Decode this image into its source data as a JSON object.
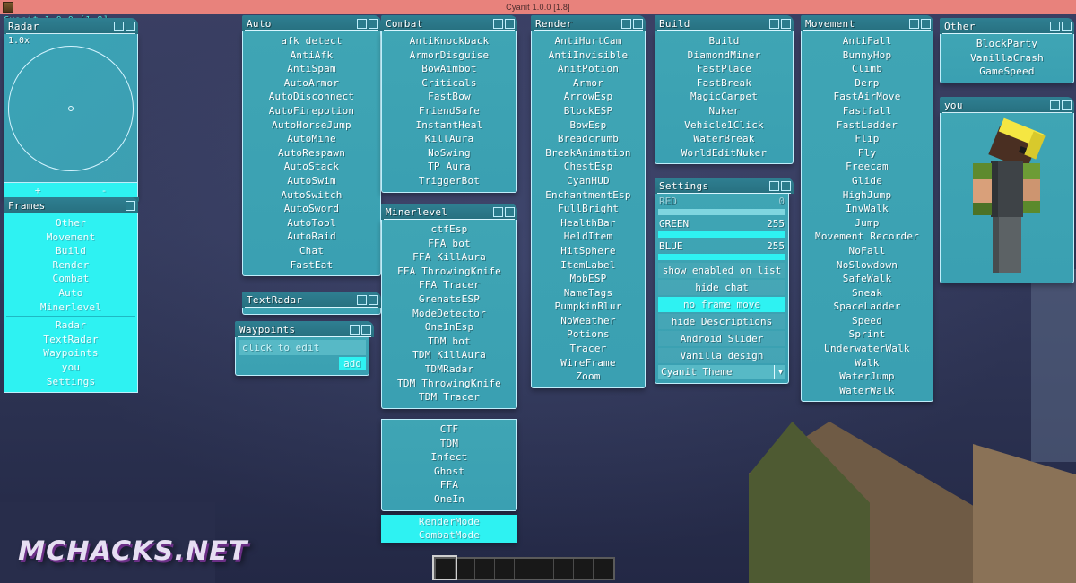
{
  "window": {
    "title": "Cyanit 1.0.0 [1.8]",
    "icon": "minecraft-grass-block-icon"
  },
  "watermark": {
    "client": "Cyanit 1.0.0 [1.8]",
    "site": "MCHACKS.NET"
  },
  "theme": {
    "accent": "#2ef2f2",
    "panel_bg": "#3fa5b4",
    "panel_header": "#2f7f92",
    "border": "#bfeefb",
    "text": "#ffffff",
    "titlebar": "#e8827c"
  },
  "panels": {
    "radar": {
      "title": "Radar",
      "scale": "1.0x",
      "zoom_in": "+",
      "zoom_out": "-"
    },
    "frames": {
      "title": "Frames",
      "group_a": [
        "Other",
        "Movement",
        "Build",
        "Render",
        "Combat",
        "Auto",
        "Minerlevel"
      ],
      "group_b": [
        "Radar",
        "TextRadar",
        "Waypoints",
        "you",
        "Settings"
      ]
    },
    "auto": {
      "title": "Auto",
      "items": [
        "afk detect",
        "AntiAfk",
        "AntiSpam",
        "AutoArmor",
        "AutoDisconnect",
        "AutoFirepotion",
        "AutoHorseJump",
        "AutoMine",
        "AutoRespawn",
        "AutoStack",
        "AutoSwim",
        "AutoSwitch",
        "AutoSword",
        "AutoTool",
        "AutoRaid",
        "Chat",
        "FastEat"
      ]
    },
    "textradar": {
      "title": "TextRadar"
    },
    "waypoints": {
      "title": "Waypoints",
      "input_placeholder": "click to edit",
      "add_label": "add"
    },
    "combat": {
      "title": "Combat",
      "items": [
        "AntiKnockback",
        "ArmorDisguise",
        "BowAimbot",
        "Criticals",
        "FastBow",
        "FriendSafe",
        "InstantHeal",
        "KillAura",
        "NoSwing",
        "TP Aura",
        "TriggerBot"
      ]
    },
    "minerlevel": {
      "title": "Minerlevel",
      "items": [
        "ctfEsp",
        "FFA bot",
        "FFA KillAura",
        "FFA ThrowingKnife",
        "FFA Tracer",
        "GrenatsESP",
        "ModeDetector",
        "OneInEsp",
        "TDM bot",
        "TDM KillAura",
        "TDMRadar",
        "TDM ThrowingKnife",
        "TDM Tracer"
      ],
      "modes": [
        "CTF",
        "TDM",
        "Infect",
        "Ghost",
        "FFA",
        "OneIn"
      ],
      "active_modes": [
        "RenderMode",
        "CombatMode"
      ]
    },
    "render": {
      "title": "Render",
      "items": [
        "AntiHurtCam",
        "AntiInvisible",
        "AnitPotion",
        "Armor",
        "ArrowEsp",
        "BlockESP",
        "BowEsp",
        "Breadcrumb",
        "BreakAnimation",
        "ChestEsp",
        "CyanHUD",
        "EnchantmentEsp",
        "FullBright",
        "HealthBar",
        "HeldItem",
        "HitSphere",
        "ItemLabel",
        "MobESP",
        "NameTags",
        "PumpkinBlur",
        "NoWeather",
        "Potions",
        "Tracer",
        "WireFrame",
        "Zoom"
      ]
    },
    "build": {
      "title": "Build",
      "items": [
        "Build",
        "DiamondMiner",
        "FastPlace",
        "FastBreak",
        "MagicCarpet",
        "Nuker",
        "Vehicle1Click",
        "WaterBreak",
        "WorldEditNuker"
      ]
    },
    "settings": {
      "title": "Settings",
      "sliders": [
        {
          "label": "RED",
          "value": "0",
          "fill": 0,
          "dim": true
        },
        {
          "label": "GREEN",
          "value": "255",
          "fill": 100,
          "dim": false
        },
        {
          "label": "BLUE",
          "value": "255",
          "fill": 100,
          "dim": false
        }
      ],
      "buttons": [
        {
          "label": "show enabled on list",
          "active": false
        },
        {
          "label": "hide chat",
          "active": false
        },
        {
          "label": "no frame move",
          "active": true
        },
        {
          "label": "hide Descriptions",
          "active": false
        },
        {
          "label": "Android Slider",
          "active": false
        },
        {
          "label": "Vanilla design",
          "active": false
        }
      ],
      "theme_selected": "Cyanit Theme"
    },
    "movement": {
      "title": "Movement",
      "items": [
        "AntiFall",
        "BunnyHop",
        "Climb",
        "Derp",
        "FastAirMove",
        "Fastfall",
        "FastLadder",
        "Flip",
        "Fly",
        "Freecam",
        "Glide",
        "HighJump",
        "InvWalk",
        "Jump",
        "Movement Recorder",
        "NoFall",
        "NoSlowdown",
        "SafeWalk",
        "Sneak",
        "SpaceLadder",
        "Speed",
        "Sprint",
        "UnderwaterWalk",
        "Walk",
        "WaterJump",
        "WaterWalk"
      ]
    },
    "other": {
      "title": "Other",
      "items": [
        "BlockParty",
        "VanillaCrash",
        "GameSpeed"
      ]
    },
    "you": {
      "title": "you"
    }
  },
  "hotbar": {
    "slot_count": 9,
    "selected_index": 0
  }
}
